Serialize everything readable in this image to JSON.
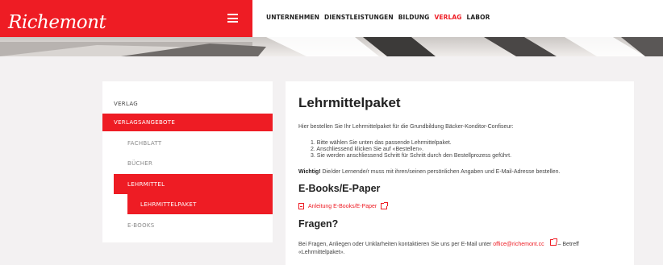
{
  "brand": {
    "logo": "Richemont",
    "accent": "#ee1c24"
  },
  "header": {
    "nav": [
      {
        "label": "UNTERNEHMEN",
        "active": false
      },
      {
        "label": "DIENSTLEISTUNGEN",
        "active": false
      },
      {
        "label": "BILDUNG",
        "active": false
      },
      {
        "label": "VERLAG",
        "active": true
      },
      {
        "label": "LABOR",
        "active": false
      }
    ]
  },
  "sidebar": {
    "items": [
      {
        "label": "VERLAG"
      },
      {
        "label": "VERLAGSANGEBOTE"
      },
      {
        "label": "FACHBLATT"
      },
      {
        "label": "BÜCHER"
      },
      {
        "label": "LEHRMITTEL"
      },
      {
        "label": "LEHRMITTELPAKET"
      },
      {
        "label": "E-BOOKS"
      }
    ]
  },
  "main": {
    "title": "Lehrmittelpaket",
    "intro": "Hier bestellen Sie Ihr Lehrmittelpaket für die Grundbildung Bäcker-Konditor-Confiseur:",
    "steps": [
      "1. Bitte wählen Sie unten das passende Lehrmittelpaket.",
      "2. Anschliessend klicken Sie auf «Bestellen».",
      "3. Sie werden anschliessend Schritt für Schritt durch den Bestellprozess geführt."
    ],
    "hint_bold": "Wichtig!",
    "hint_text": " Die/der Lernende/r muss mit ihren/seinen persönlichen Angaben und E-Mail-Adresse bestellen.",
    "ebooks_heading": "E-Books/E-Paper",
    "ebooks_link": "Anleitung E-Books/E-Paper",
    "questions_heading": "Fragen?",
    "contact_before": "Bei Fragen, Anliegen oder Unklarheiten kontaktieren Sie uns per E-Mail unter ",
    "contact_email": "office@richemont.cc",
    "contact_after": " – Betreff",
    "contact_subject": "«Lehrmittelpaket»."
  }
}
